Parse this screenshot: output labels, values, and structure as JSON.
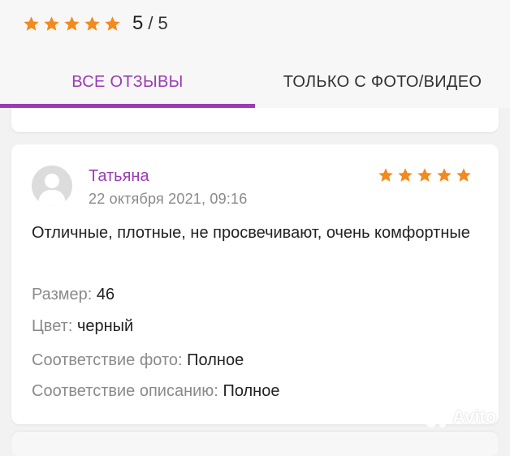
{
  "summary": {
    "rating_value": 5,
    "score": "5",
    "separator": "/",
    "max": "5",
    "star_color": "#f28a1f"
  },
  "tabs": [
    {
      "label": "ВСЕ ОТЗЫВЫ",
      "active": true
    },
    {
      "label": "ТОЛЬКО С ФОТО/ВИДЕО",
      "active": false
    }
  ],
  "accent_color": "#9a3bb6",
  "review": {
    "author": "Татьяна",
    "date": "22 октября 2021, 09:16",
    "rating": 5,
    "text": "Отличные, плотные, не просвечивают, очень комфортные",
    "properties": [
      {
        "key": "Размер:",
        "value": "46"
      },
      {
        "key": "Цвет:",
        "value": "черный"
      },
      {
        "key": "Соответствие фото:",
        "value": "Полное"
      },
      {
        "key": "Соответствие описанию:",
        "value": "Полное"
      }
    ]
  },
  "watermark": {
    "text": "Avito"
  }
}
